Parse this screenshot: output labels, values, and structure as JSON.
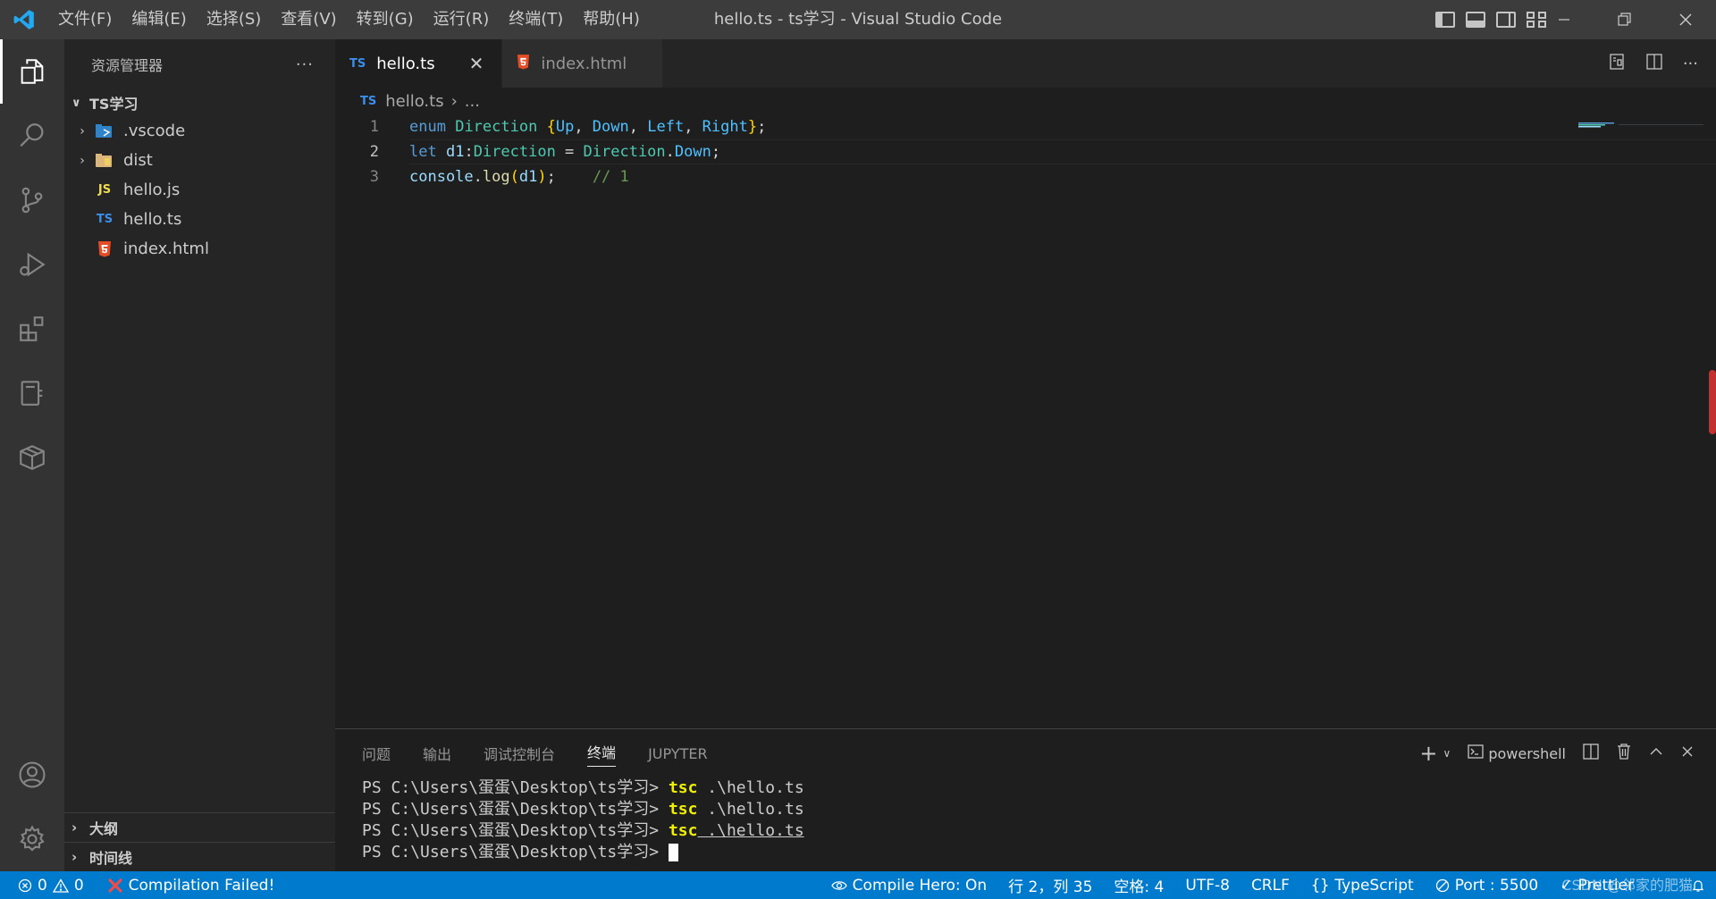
{
  "titlebar": {
    "title": "hello.ts - ts学习 - Visual Studio Code",
    "menu": [
      "文件(F)",
      "编辑(E)",
      "选择(S)",
      "查看(V)",
      "转到(G)",
      "运行(R)",
      "终端(T)",
      "帮助(H)"
    ]
  },
  "sidebar": {
    "title": "资源管理器",
    "more": "···",
    "root": "TS学习",
    "items": [
      {
        "label": ".vscode",
        "icon": "vscode-folder-icon",
        "folder": true
      },
      {
        "label": "dist",
        "icon": "folder-icon",
        "folder": true
      },
      {
        "label": "hello.js",
        "icon": "JS",
        "folder": false
      },
      {
        "label": "hello.ts",
        "icon": "TS",
        "folder": false
      },
      {
        "label": "index.html",
        "icon": "html5-icon",
        "folder": false
      }
    ],
    "outline": "大纲",
    "timeline": "时间线"
  },
  "tabs": [
    {
      "label": "hello.ts",
      "icon": "TS",
      "active": true,
      "close": "✕"
    },
    {
      "label": "index.html",
      "icon": "html5-icon",
      "active": false
    }
  ],
  "breadcrumb": {
    "icon": "TS",
    "file": "hello.ts",
    "sep": "›",
    "more": "..."
  },
  "code": {
    "line_numbers": [
      "1",
      "2",
      "3"
    ],
    "line1": {
      "kw": "enum",
      "type": "Direction",
      "open": "{",
      "m1": "Up",
      "c1": ", ",
      "m2": "Down",
      "c2": ", ",
      "m3": "Left",
      "c3": ", ",
      "m4": "Right",
      "close": "}",
      "end": ";"
    },
    "line2": {
      "kw": "let",
      "var": " d1",
      "colon": ":",
      "type": "Direction",
      "eq": " = ",
      "obj": "Direction",
      "dot": ".",
      "prop": "Down",
      "end": ";"
    },
    "line3": {
      "obj": "console",
      "dot": ".",
      "fn": "log",
      "p1": "(",
      "var": "d1",
      "p2": ")",
      "end": ";",
      "gap": "    ",
      "comment": "// 1"
    }
  },
  "panel": {
    "tabs": [
      "问题",
      "输出",
      "调试控制台",
      "终端",
      "JUPYTER"
    ],
    "active_tab": "终端",
    "shell": "powershell",
    "terminal": {
      "prompt": "PS C:\\Users\\蛋蛋\\Desktop\\ts学习> ",
      "cmd": "tsc",
      "arg": " .\\hello.ts",
      "lines": 3
    }
  },
  "statusbar": {
    "errors": "0",
    "warnings": "0",
    "compile_status": "Compilation Failed!",
    "compile_hero": "Compile Hero: On",
    "position": "行 2，列 35",
    "spaces": "空格: 4",
    "encoding": "UTF-8",
    "eol": "CRLF",
    "language": "TypeScript",
    "port": "Port : 5500",
    "prettier": "Prettier",
    "watermark": "CSDN @邻家的肥猫"
  },
  "colors": {
    "accent": "#007acc",
    "ts": "#3b8eea",
    "js": "#f0db4f",
    "html": "#e44d26",
    "error": "#f14c4c"
  }
}
